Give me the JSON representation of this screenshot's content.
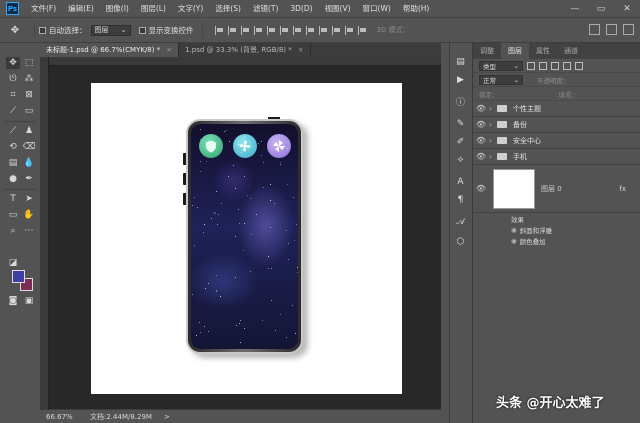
{
  "menubar": {
    "logo": "Ps",
    "items": [
      "文件(F)",
      "编辑(E)",
      "图像(I)",
      "图层(L)",
      "文字(Y)",
      "选择(S)",
      "滤镜(T)",
      "3D(D)",
      "视图(V)",
      "窗口(W)",
      "帮助(H)"
    ],
    "min": "—",
    "max": "▭",
    "close": "✕"
  },
  "options": {
    "tool_icon": "✥",
    "auto_select_label": "自动选择：",
    "auto_select_value": "图层",
    "show_transform_label": "显示变换控件",
    "mode_3d_label": "3D 模式："
  },
  "tabs": [
    {
      "label": "未标题-1.psd @ 66.7%(CMYK/8) *",
      "close": "×"
    },
    {
      "label": "1.psd @ 33.3% (背景, RGB/8) *",
      "close": "×"
    }
  ],
  "statusbar": {
    "zoom": "66.67%",
    "info": "文档:2.44M/8.29M",
    "arrow": ">"
  },
  "panel": {
    "tabs": [
      "调整",
      "图层",
      "属性",
      "通道"
    ],
    "filter_kind": "类型",
    "blend_mode": "正常",
    "opacity_label": "不透明度：",
    "lock_label": "锁定：",
    "fill_label": "填充："
  },
  "layers": {
    "groups": [
      "个性主题",
      "备份",
      "安全中心",
      "手机"
    ],
    "layer0_name": "图层 0",
    "fx": "fx",
    "effects_label": "效果",
    "effects": [
      "斜面和浮雕",
      "颜色叠加"
    ]
  },
  "colors": {
    "foreground": "#3d3fa6",
    "background": "#7a2e56",
    "accent": "#31a8ff"
  },
  "watermark": "头条 @开心太难了",
  "app_icons": [
    "shield-icon",
    "fan-icon",
    "pinwheel-icon"
  ]
}
